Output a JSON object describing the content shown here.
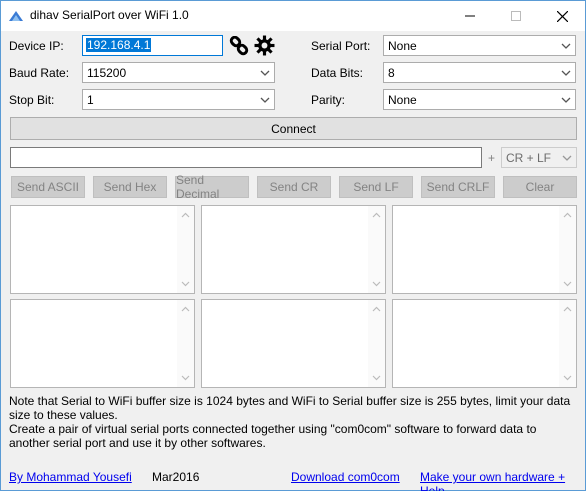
{
  "window": {
    "title": "dihav SerialPort over WiFi 1.0"
  },
  "icons": {
    "app": "wifi-app-icon",
    "link": "chain-link-icon",
    "settings": "gear-icon",
    "minimize": "minimize-icon",
    "maximize": "maximize-icon",
    "close": "close-icon"
  },
  "form": {
    "device_ip_label": "Device IP:",
    "device_ip_value": "192.168.4.1",
    "serial_port_label": "Serial Port:",
    "serial_port_value": "None",
    "baud_rate_label": "Baud Rate:",
    "baud_rate_value": "115200",
    "data_bits_label": "Data Bits:",
    "data_bits_value": "8",
    "stop_bit_label": "Stop Bit:",
    "stop_bit_value": "1",
    "parity_label": "Parity:",
    "parity_value": "None"
  },
  "connect_label": "Connect",
  "send": {
    "input_value": "",
    "plus": "+",
    "line_ending": "CR + LF",
    "buttons": [
      "Send ASCII",
      "Send Hex",
      "Send Decimal",
      "Send CR",
      "Send LF",
      "Send CRLF",
      "Clear"
    ]
  },
  "notes": {
    "line1": "Note that Serial to WiFi buffer size is 1024 bytes and WiFi to Serial buffer size is 255 bytes, limit your data size to these values.",
    "line2": "Create a pair of virtual serial ports connected together using \"com0com\" software to forward data to another serial port and use it by other softwares."
  },
  "footer": {
    "author": "By Mohammad Yousefi",
    "date": "Mar2016",
    "download": "Download com0com",
    "help": "Make your own hardware + Help"
  },
  "colors": {
    "accent": "#0078d7",
    "link": "#0000ee",
    "window_border": "#5a9bd5"
  }
}
